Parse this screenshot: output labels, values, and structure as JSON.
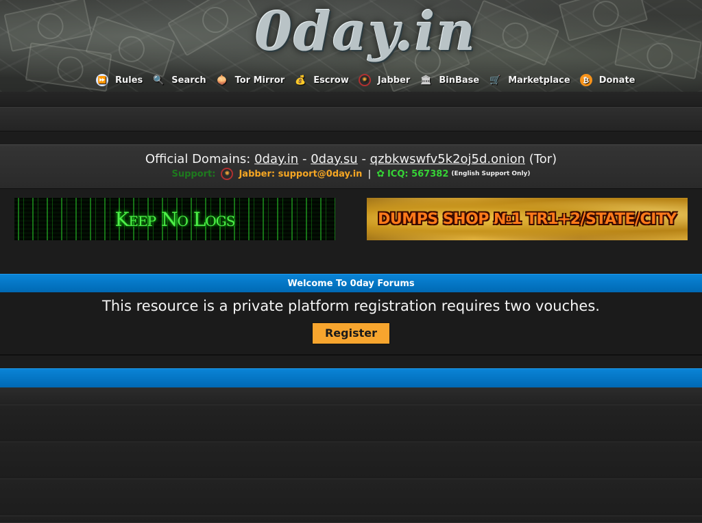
{
  "header": {
    "logo_text": "0day.in",
    "nav": [
      {
        "label": "Rules",
        "icon": "rules-icon",
        "glyph": "⏩"
      },
      {
        "label": "Search",
        "icon": "search-icon",
        "glyph": "🔍"
      },
      {
        "label": "Tor Mirror",
        "icon": "tor-onion-icon",
        "glyph": "🧅"
      },
      {
        "label": "Escrow",
        "icon": "money-bag-icon",
        "glyph": "💰"
      },
      {
        "label": "Jabber",
        "icon": "jabber-icon",
        "glyph": "✺"
      },
      {
        "label": "BinBase",
        "icon": "bank-icon",
        "glyph": "🏛"
      },
      {
        "label": "Marketplace",
        "icon": "cart-icon",
        "glyph": "🛒"
      },
      {
        "label": "Donate",
        "icon": "bitcoin-icon",
        "glyph": "₿"
      }
    ]
  },
  "domains": {
    "prefix": "Official Domains:",
    "domain1": "0day.in",
    "dash1": "-",
    "domain2": "0day.su",
    "dash2": "-",
    "domain3": "qzbkwswfv5k2oj5d.onion",
    "suffix": "(Tor)",
    "support_label": "Support:",
    "jabber_text": "Jabber: support@0day.in",
    "separator": "|",
    "icq_text": "ICQ: 567382",
    "english_note": "(English Support Only)"
  },
  "banners": {
    "left_text": "Keep No Logs",
    "right_text": "DUMPS SHOP №1 TR1+2/STATE/CITY"
  },
  "welcome": {
    "title": "Welcome To 0day Forums",
    "message": "This resource is a private platform registration requires two vouches.",
    "register_label": "Register"
  },
  "colors": {
    "accent_blue": "#0078c8",
    "register_orange": "#f7a52e",
    "support_green": "#1e7a1e",
    "jabber_orange": "#f5a623",
    "icq_green": "#36d436"
  }
}
